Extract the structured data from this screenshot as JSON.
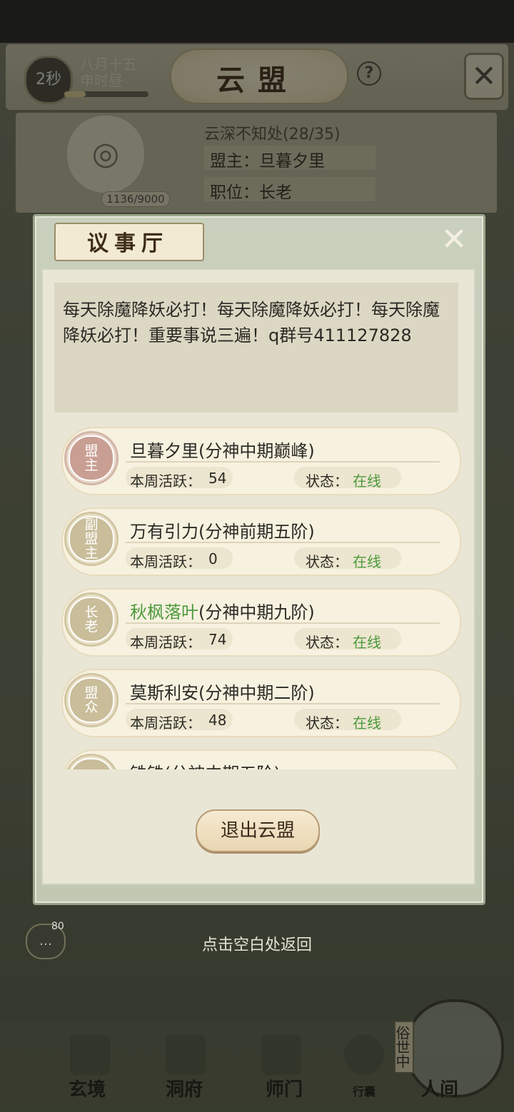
{
  "header": {
    "timer": "2秒",
    "date_line1": "八月十五",
    "date_line2": "申时昼",
    "title": "云盟",
    "help_label": "?",
    "close_label": "✕"
  },
  "alliance": {
    "name": "云深不知处(28/35)",
    "leader": "盟主：旦暮夕里",
    "position": "职位：长老",
    "exp": "1136/9000",
    "progress_fraction": 0.25
  },
  "modal": {
    "title": "议事厅",
    "close_label": "✕",
    "notice": "每天除魔降妖必打！每天除魔降妖必打！每天除魔降妖必打！重要事说三遍！q群号411127828"
  },
  "members": [
    {
      "role": "盟主",
      "role_type": "leader",
      "name": "旦暮夕里",
      "realm": "(分神中期巅峰)",
      "name_color": "#2b2b25",
      "activity_label": "本周活跃：",
      "activity": "54",
      "status_label": "状态：",
      "status": "在线"
    },
    {
      "role": "副盟主",
      "role_type": "normal",
      "name": "万有引力",
      "realm": "(分神前期五阶)",
      "name_color": "#2b2b25",
      "activity_label": "本周活跃：",
      "activity": "0",
      "status_label": "状态：",
      "status": "在线"
    },
    {
      "role": "长老",
      "role_type": "normal",
      "name": "秋枫落叶",
      "realm": "(分神中期九阶)",
      "name_color": "#4c9a3c",
      "activity_label": "本周活跃：",
      "activity": "74",
      "status_label": "状态：",
      "status": "在线"
    },
    {
      "role": "盟众",
      "role_type": "normal",
      "name": "莫斯利安",
      "realm": "(分神中期二阶)",
      "name_color": "#2b2b25",
      "activity_label": "本周活跃：",
      "activity": "48",
      "status_label": "状态：",
      "status": "在线"
    }
  ],
  "partial_member": {
    "name": "铢铢",
    "realm": "(分神中期五阶)"
  },
  "exit_button": "退出云盟",
  "back_hint": "点击空白处返回",
  "chat": {
    "count": "80"
  },
  "nav": {
    "items": [
      "玄境",
      "洞府",
      "师门",
      "行囊",
      "人间"
    ],
    "world_tab": "俗世中"
  },
  "colors": {
    "online": "#4c9a3c",
    "accent": "#c99f93"
  }
}
